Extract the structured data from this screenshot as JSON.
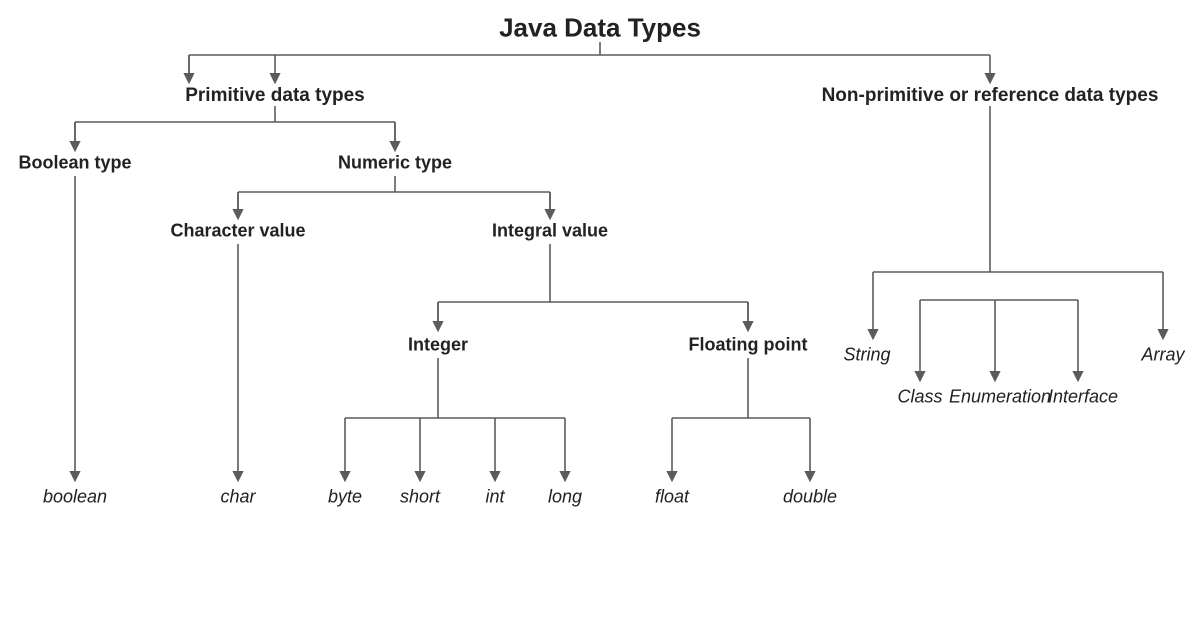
{
  "title": "Java Data Types",
  "primitive": {
    "label": "Primitive data types",
    "boolean_type": {
      "label": "Boolean type",
      "leaf": "boolean"
    },
    "numeric": {
      "label": "Numeric type",
      "character": {
        "label": "Character value",
        "leaf": "char"
      },
      "integral": {
        "label": "Integral value",
        "integer": {
          "label": "Integer",
          "leaves": {
            "byte": "byte",
            "short": "short",
            "int": "int",
            "long": "long"
          }
        },
        "floating": {
          "label": "Floating point",
          "leaves": {
            "float": "float",
            "double": "double"
          }
        }
      }
    }
  },
  "nonprimitive": {
    "label": "Non-primitive or reference data types",
    "leaves": {
      "string": "String",
      "class": "Class",
      "enum": "Enumeration",
      "interface": "Interface",
      "array": "Array"
    }
  }
}
